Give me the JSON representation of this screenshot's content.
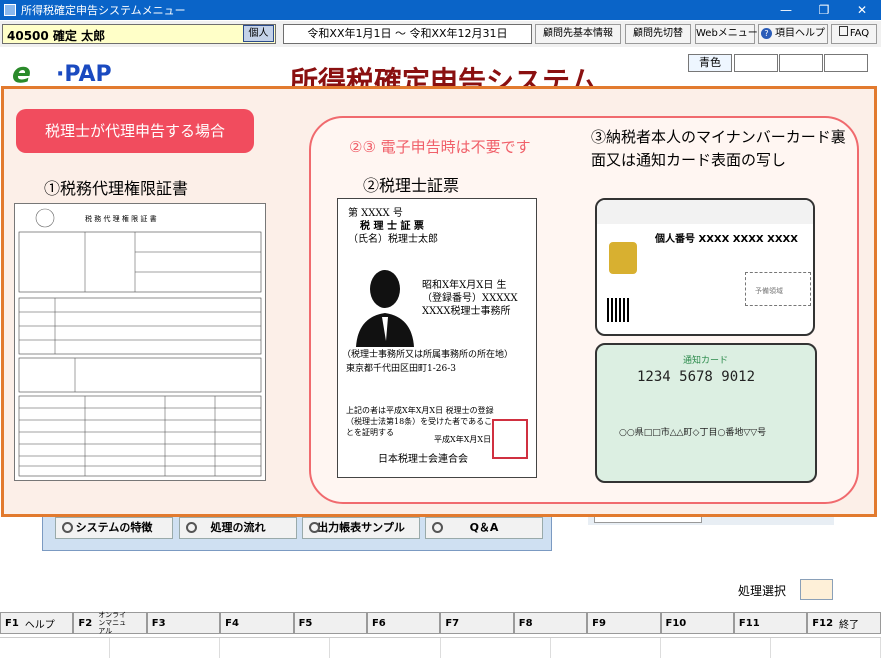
{
  "window": {
    "title": "所得税確定申告システムメニュー",
    "minimize": "—",
    "restore": "❐",
    "close": "✕"
  },
  "toolbar": {
    "client_name": "40500 確定 太郎",
    "kojin_label": "個人",
    "period": "令和XX年1月1日 ～ 令和XX年12月31日",
    "buttons": [
      {
        "label": "顧問先基本情報"
      },
      {
        "label": "顧問先切替"
      },
      {
        "label": "Webメニュー"
      },
      {
        "label": "項目ヘルプ"
      },
      {
        "label": "FAQ"
      }
    ]
  },
  "header": {
    "logo_e": "e",
    "logo_pap": "·PAP",
    "system_title": "所得税確定申告システム",
    "color_label": "青色"
  },
  "overlay": {
    "title": "税理士が代理申告する場合",
    "doc1_heading": "①税務代理権限証書",
    "note": "②③ 電子申告時は不要です",
    "doc2_heading": "②税理士証票",
    "doc3_heading": "③納税者本人のマイナンバーカード裏面又は通知カード表面の写し",
    "form_title": "税 務 代 理 権 限 証 書",
    "certificate": {
      "number": "第 XXXX 号",
      "title": "税 理 士 証 票",
      "name_line": "（氏名）税理士太郎",
      "birth": "昭和X年X月X日 生",
      "reg_no": "（登録番号）XXXXX",
      "office": "XXXX税理士事務所",
      "address_label": "（税理士事務所又は所属事務所の所在地）",
      "address": "東京都千代田区田町1-26-3",
      "footer_text": "上記の者は平成X年X月X日 税理士の登録（税理士法第18条）を受けた者であることを証明する",
      "footer_date": "平成X年X月X日",
      "issuer": "日本税理士会連合会"
    },
    "mynumber_card": {
      "label": "個人番号 XXXX XXXX XXXX",
      "area_label": "予備領域"
    },
    "notice_card": {
      "label": "通知カード",
      "number": "1234 5678 9012",
      "address": "○○県□□市△△町◇丁目○番地▽▽号"
    }
  },
  "bottom_buttons": [
    {
      "label": "システムの特徴"
    },
    {
      "label": "処理の流れ"
    },
    {
      "label": "出力帳表サンプル"
    },
    {
      "label": "Q＆A"
    }
  ],
  "process_select_label": "処理選択",
  "fkeys": [
    {
      "key": "F1",
      "label": "ヘルプ"
    },
    {
      "key": "F2",
      "label": "オンラインマニュアル"
    },
    {
      "key": "F3",
      "label": ""
    },
    {
      "key": "F4",
      "label": ""
    },
    {
      "key": "F5",
      "label": ""
    },
    {
      "key": "F6",
      "label": ""
    },
    {
      "key": "F7",
      "label": ""
    },
    {
      "key": "F8",
      "label": ""
    },
    {
      "key": "F9",
      "label": ""
    },
    {
      "key": "F10",
      "label": ""
    },
    {
      "key": "F11",
      "label": ""
    },
    {
      "key": "F12",
      "label": "終了"
    }
  ]
}
